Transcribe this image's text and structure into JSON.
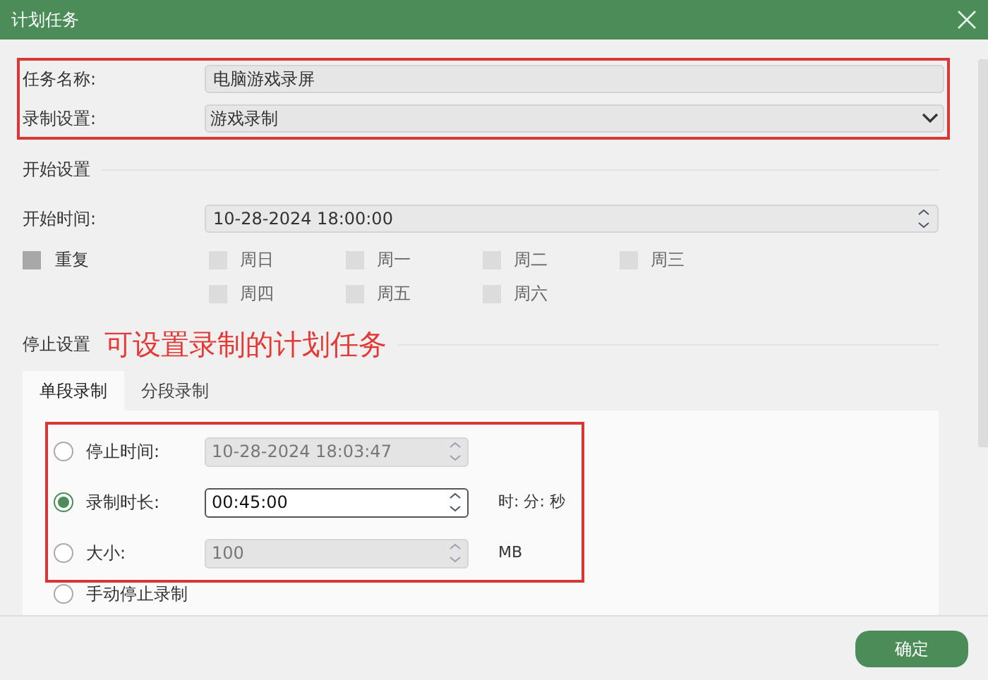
{
  "window": {
    "title": "计划任务"
  },
  "task_name": {
    "label": "任务名称:",
    "value": "电脑游戏录屏"
  },
  "record_setting": {
    "label": "录制设置:",
    "value": "游戏录制"
  },
  "start": {
    "heading": "开始设置",
    "time_label": "开始时间:",
    "time_value": "10-28-2024 18:00:00",
    "repeat": {
      "label": "重复",
      "checked": false
    },
    "days": [
      {
        "label": "周日",
        "disabled": true
      },
      {
        "label": "周一",
        "disabled": true
      },
      {
        "label": "周二",
        "disabled": true
      },
      {
        "label": "周三",
        "disabled": true
      },
      {
        "label": "周四",
        "disabled": true
      },
      {
        "label": "周五",
        "disabled": true
      },
      {
        "label": "周六",
        "disabled": true
      }
    ]
  },
  "stop": {
    "heading": "停止设置"
  },
  "annotation": "可设置录制的计划任务",
  "tabs": [
    {
      "label": "单段录制",
      "selected": true
    },
    {
      "label": "分段录制",
      "selected": false
    }
  ],
  "options": [
    {
      "label": "停止时间:",
      "selected": false,
      "disabled": true,
      "value": "10-28-2024 18:03:47"
    },
    {
      "label": "录制时长:",
      "selected": true,
      "disabled": false,
      "value": "00:45:00",
      "unit": "时: 分: 秒"
    },
    {
      "label": "大小:",
      "selected": false,
      "disabled": true,
      "value": "100",
      "unit": "MB"
    },
    {
      "label": "手动停止录制",
      "selected": false
    }
  ],
  "buttons": [
    {
      "label": "确定"
    }
  ]
}
